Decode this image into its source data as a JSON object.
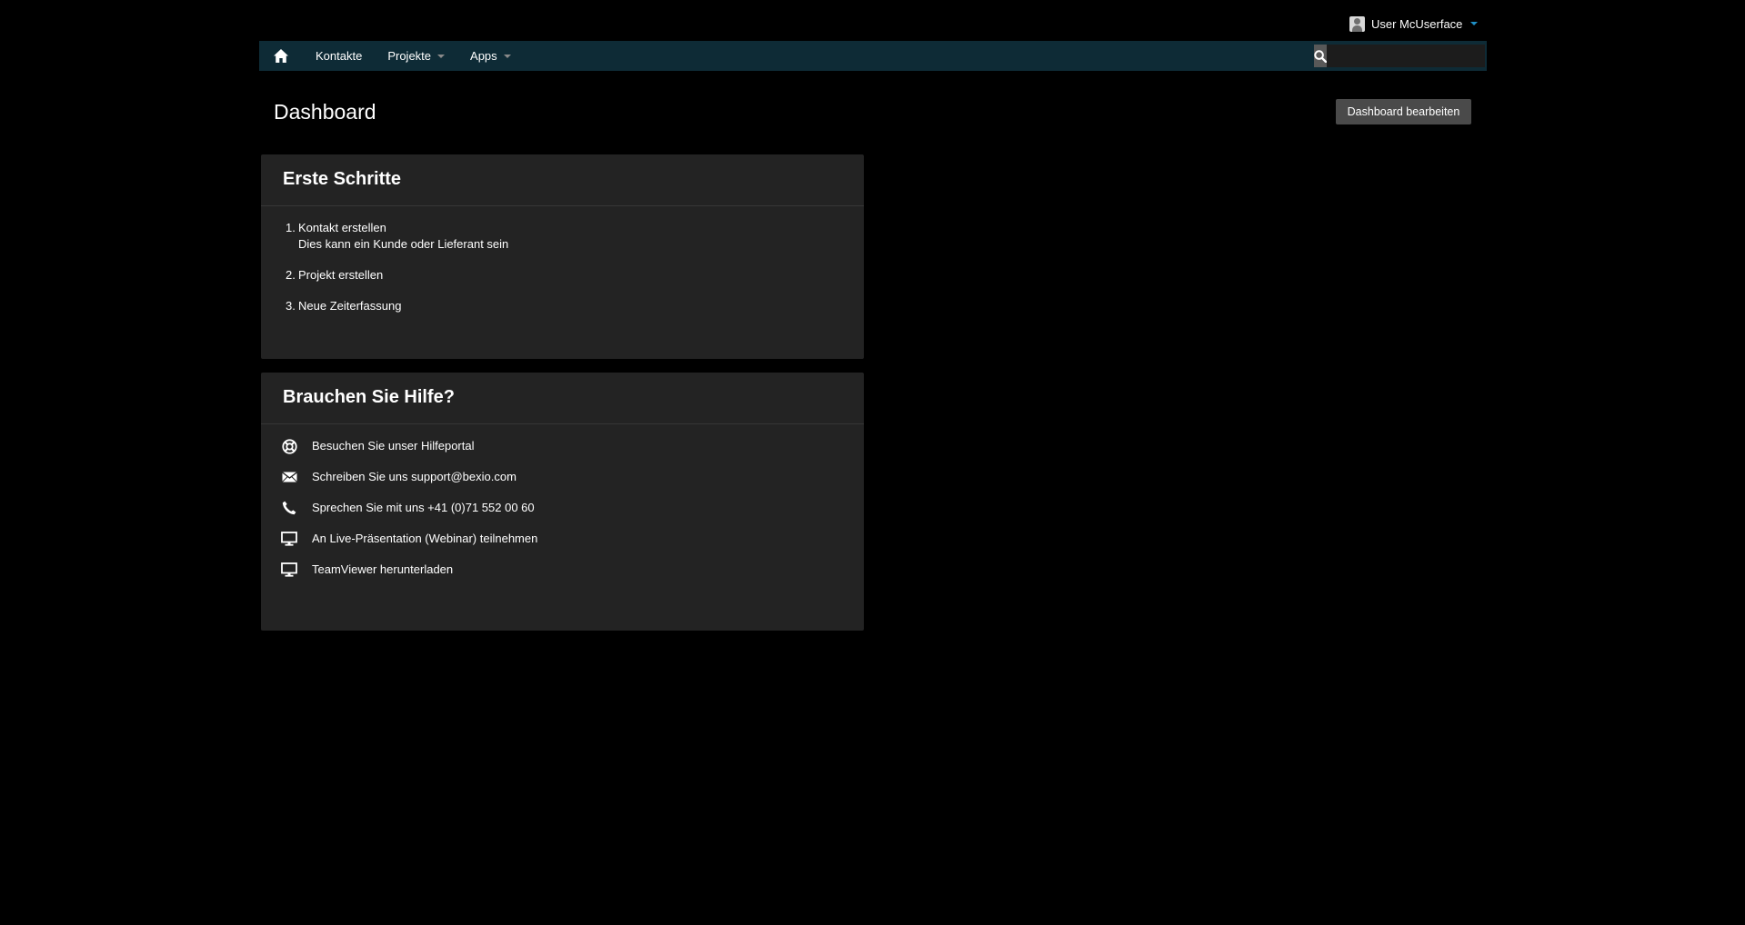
{
  "user_menu": {
    "name": "User McUserface"
  },
  "nav": {
    "items": [
      {
        "label": "Kontakte"
      },
      {
        "label": "Projekte"
      },
      {
        "label": "Apps"
      }
    ],
    "search_placeholder": ""
  },
  "page": {
    "title": "Dashboard",
    "edit_button": "Dashboard bearbeiten"
  },
  "panels": {
    "first_steps": {
      "title": "Erste Schritte",
      "steps": [
        {
          "number": "1.",
          "label": "Kontakt erstellen",
          "sub": "Dies kann ein Kunde oder Lieferant sein"
        },
        {
          "number": "2.",
          "label": "Projekt erstellen"
        },
        {
          "number": "3.",
          "label": "Neue Zeiterfassung"
        }
      ]
    },
    "help": {
      "title": "Brauchen Sie Hilfe?",
      "items": [
        {
          "icon": "lifebuoy-icon",
          "label": "Besuchen Sie unser Hilfeportal"
        },
        {
          "icon": "envelope-icon",
          "label": "Schreiben Sie uns support@bexio.com"
        },
        {
          "icon": "phone-icon",
          "label": "Sprechen Sie mit uns +41 (0)71 552 00 60"
        },
        {
          "icon": "monitor-icon",
          "label": "An Live-Präsentation (Webinar) teilnehmen"
        },
        {
          "icon": "monitor-icon",
          "label": "TeamViewer herunterladen"
        }
      ]
    }
  },
  "colors": {
    "background": "#000000",
    "navbar": "#0e2b36",
    "panel": "#232323",
    "button": "#4a4a4a",
    "accent": "#1f8fc5"
  }
}
